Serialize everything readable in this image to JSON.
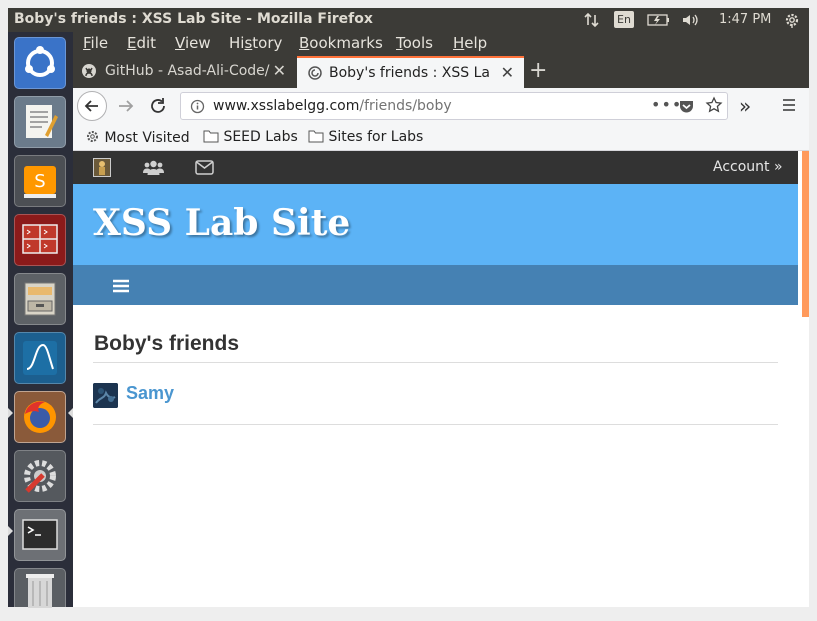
{
  "panel": {
    "window_title": "Boby's friends : XSS Lab Site - Mozilla Firefox",
    "language": "En",
    "time": "1:47 PM"
  },
  "launcher": {
    "apps": [
      "ubuntu-dash-icon",
      "text-editor-icon",
      "sublime-text-icon",
      "terminal-split-icon",
      "file-manager-icon",
      "wireshark-icon",
      "firefox-icon",
      "settings-icon",
      "terminal-icon",
      "trash-icon"
    ]
  },
  "menubar": {
    "items": [
      {
        "label": "File",
        "mnemonic": "F",
        "rest": "ile"
      },
      {
        "label": "Edit",
        "mnemonic": "E",
        "rest": "dit"
      },
      {
        "label": "View",
        "mnemonic": "V",
        "rest": "iew"
      },
      {
        "label": "History",
        "pre": "Hi",
        "mnemonic": "s",
        "rest": "tory"
      },
      {
        "label": "Bookmarks",
        "mnemonic": "B",
        "rest": "ookmarks"
      },
      {
        "label": "Tools",
        "mnemonic": "T",
        "rest": "ools"
      },
      {
        "label": "Help",
        "mnemonic": "H",
        "rest": "elp"
      }
    ]
  },
  "tabs": [
    {
      "title": "GitHub - Asad-Ali-Code/"
    },
    {
      "title": "Boby's friends : XSS Lab"
    }
  ],
  "urlbar": {
    "domain": "www.xsslabelgg.com",
    "path": "/friends/boby"
  },
  "bookmarks": {
    "items": [
      "Most Visited",
      "SEED Labs",
      "Sites for Labs"
    ]
  },
  "site": {
    "account_label": "Account",
    "account_chevron": "»",
    "site_title": "XSS Lab Site",
    "page_heading": "Boby's friends",
    "friends": [
      {
        "name": "Samy"
      }
    ]
  },
  "colors": {
    "header_blue": "#5cb3f6",
    "menu_blue": "#4581b3",
    "topbar": "#333333",
    "link": "#4a96d0",
    "active_tab_accent": "#ff7139"
  }
}
